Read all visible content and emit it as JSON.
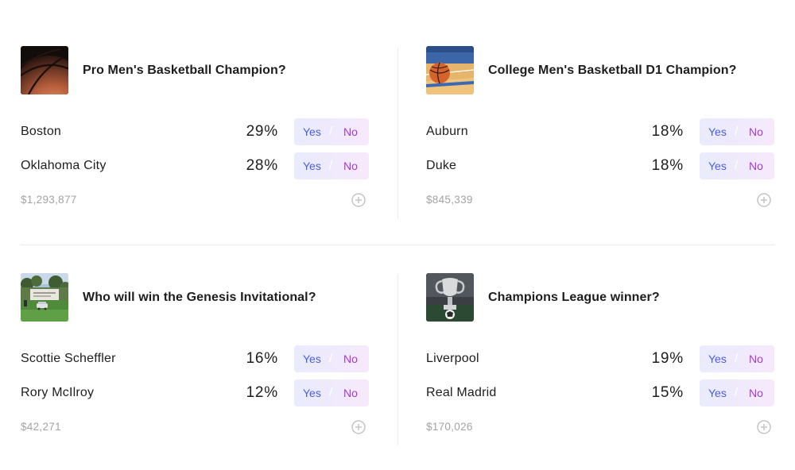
{
  "markets": [
    {
      "title": "Pro Men's Basketball Champion?",
      "thumbnail_icon": "basketball-closeup-image",
      "volume": "$1,293,877",
      "outcomes": [
        {
          "name": "Boston",
          "percent": "29%",
          "yes_label": "Yes",
          "no_label": "No"
        },
        {
          "name": "Oklahoma City",
          "percent": "28%",
          "yes_label": "Yes",
          "no_label": "No"
        }
      ]
    },
    {
      "title": "College Men's Basketball D1 Champion?",
      "thumbnail_icon": "basketball-on-court-image",
      "volume": "$845,339",
      "outcomes": [
        {
          "name": "Auburn",
          "percent": "18%",
          "yes_label": "Yes",
          "no_label": "No"
        },
        {
          "name": "Duke",
          "percent": "18%",
          "yes_label": "Yes",
          "no_label": "No"
        }
      ]
    },
    {
      "title": "Who will win the Genesis Invitational?",
      "thumbnail_icon": "golf-course-image",
      "volume": "$42,271",
      "outcomes": [
        {
          "name": "Scottie Scheffler",
          "percent": "16%",
          "yes_label": "Yes",
          "no_label": "No"
        },
        {
          "name": "Rory McIlroy",
          "percent": "12%",
          "yes_label": "Yes",
          "no_label": "No"
        }
      ]
    },
    {
      "title": "Champions League winner?",
      "thumbnail_icon": "trophy-image",
      "volume": "$170,026",
      "outcomes": [
        {
          "name": "Liverpool",
          "percent": "19%",
          "yes_label": "Yes",
          "no_label": "No"
        },
        {
          "name": "Real Madrid",
          "percent": "15%",
          "yes_label": "Yes",
          "no_label": "No"
        }
      ]
    }
  ],
  "colors": {
    "yes": "#4a5de0",
    "no": "#a638d6",
    "muted": "#a3a3a3",
    "divider": "#ececec"
  }
}
